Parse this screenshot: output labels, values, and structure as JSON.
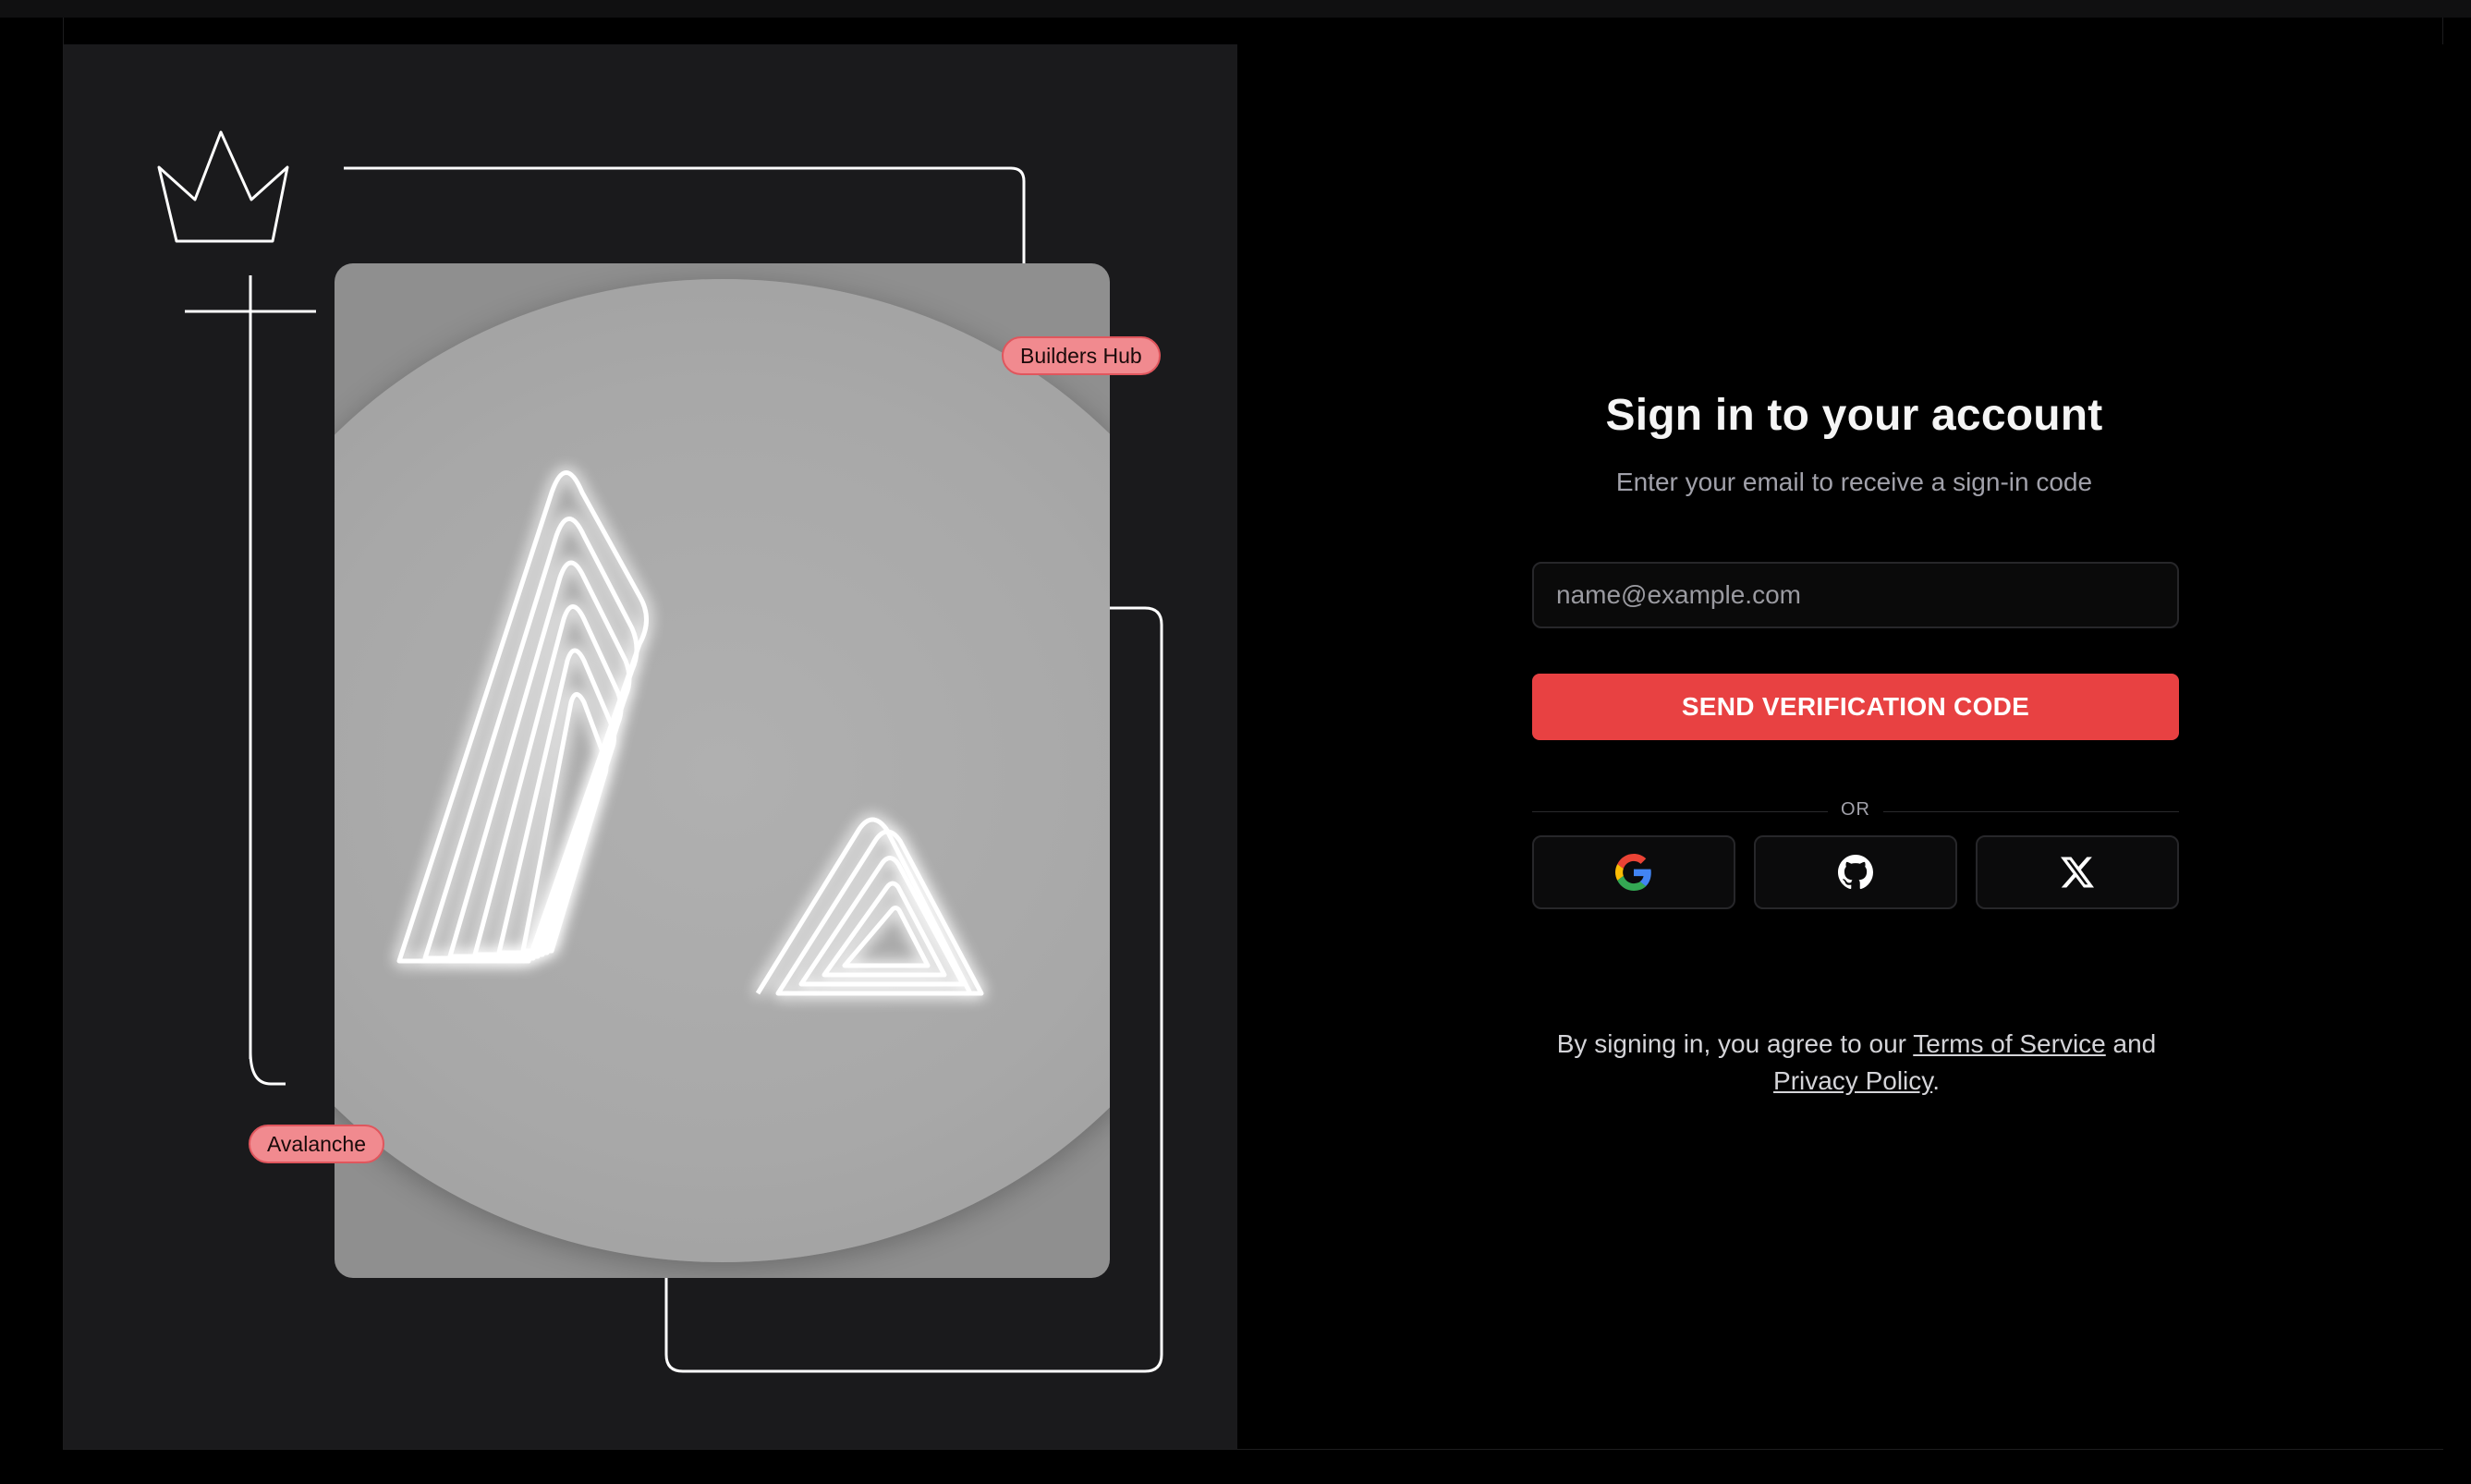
{
  "art_panel": {
    "tags": {
      "builders_hub": "Builders Hub",
      "avalanche": "Avalanche"
    },
    "icons": {
      "crown": "crown-icon",
      "logo": "avalanche-logo"
    }
  },
  "signin": {
    "title": "Sign in to your account",
    "subtitle": "Enter your email to receive a sign-in code",
    "email_placeholder": "name@example.com",
    "email_value": "",
    "send_button": "SEND VERIFICATION CODE",
    "divider": "OR",
    "social": [
      {
        "provider": "Google",
        "icon": "google-icon"
      },
      {
        "provider": "GitHub",
        "icon": "github-icon"
      },
      {
        "provider": "X",
        "icon": "x-icon"
      }
    ],
    "legal": {
      "prefix": "By signing in, you agree to our ",
      "terms": "Terms of Service",
      "middle": " and",
      "privacy": "Privacy Policy",
      "suffix": "."
    }
  },
  "colors": {
    "accent": "#e84142",
    "tag_bg": "#f18a8f",
    "panel_bg": "#1a1a1c",
    "page_bg": "#000000"
  }
}
